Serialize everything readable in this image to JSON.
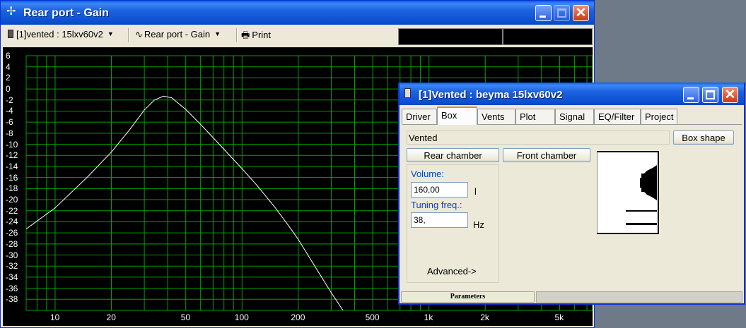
{
  "main_window": {
    "title": "Rear port - Gain",
    "toolbar": {
      "project_dropdown": "[1]vented : 15lxv60v2",
      "graph_dropdown": "Rear port - Gain",
      "print_label": "Print"
    }
  },
  "chart_data": {
    "type": "line",
    "title": "",
    "xlabel": "",
    "ylabel": "",
    "x_scale": "log",
    "xlim": [
      7,
      7500
    ],
    "ylim": [
      -40,
      6
    ],
    "y_ticks": [
      "6",
      "4",
      "2",
      "0",
      "-2",
      "-4",
      "-6",
      "-8",
      "-10",
      "-12",
      "-14",
      "-16",
      "-18",
      "-20",
      "-22",
      "-24",
      "-26",
      "-28",
      "-30",
      "-32",
      "-34",
      "-36",
      "-38"
    ],
    "x_ticks": [
      "10",
      "20",
      "50",
      "100",
      "200",
      "500",
      "1k",
      "2k",
      "5k"
    ],
    "x_tick_values": [
      10,
      20,
      50,
      100,
      200,
      500,
      1000,
      2000,
      5000
    ],
    "grid": true,
    "grid_color": "#00a000",
    "line_color": "#ffffff",
    "series": [
      {
        "x": [
          7,
          10,
          15,
          20,
          25,
          30,
          34,
          38,
          42,
          50,
          60,
          70,
          80,
          100,
          120,
          150,
          180,
          200,
          250,
          300,
          350,
          420
        ],
        "values": [
          -25.3,
          -21.5,
          -15.8,
          -11.4,
          -7.4,
          -3.8,
          -2.0,
          -1.3,
          -1.6,
          -3.7,
          -6.4,
          -8.8,
          -10.9,
          -14.4,
          -17.4,
          -21.4,
          -25.0,
          -27.2,
          -32.5,
          -36.8,
          -40.2,
          -44.0
        ]
      }
    ]
  },
  "dialog": {
    "title": "[1]Vented : beyma 15lxv60v2",
    "tabs": [
      "Driver",
      "Box",
      "Vents",
      "Plot",
      "Signal",
      "EQ/Filter",
      "Project"
    ],
    "active_tab": "Box",
    "box_type": "Vented",
    "box_shape_button": "Box shape",
    "rear_chamber_button": "Rear chamber",
    "front_chamber_button": "Front chamber",
    "volume_label": "Volume:",
    "volume_value": "160,00",
    "volume_unit": "l",
    "tuning_label": "Tuning freq.:",
    "tuning_value": "38,",
    "tuning_unit": "Hz",
    "advanced_button": "Advanced->",
    "status_pane": "Parameters"
  }
}
